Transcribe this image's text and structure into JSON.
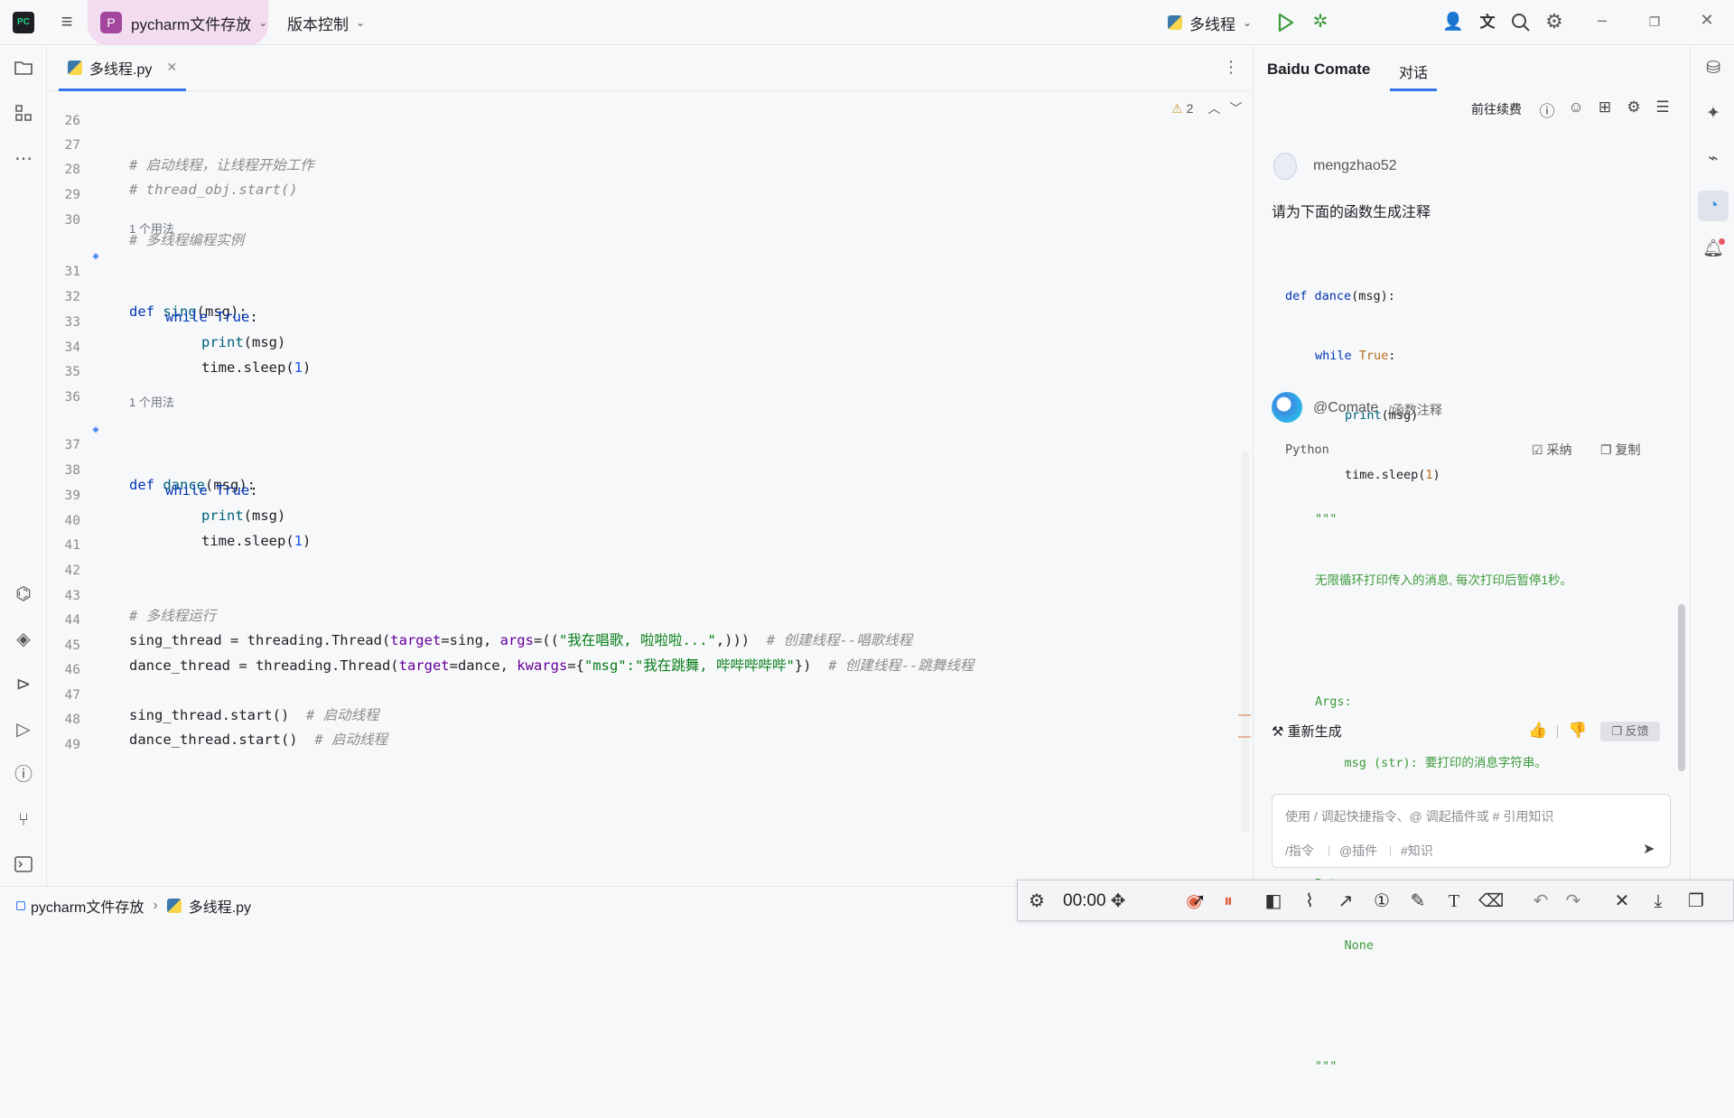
{
  "titlebar": {
    "project_badge": "P",
    "project_name": "pycharm文件存放",
    "vcs_label": "版本控制",
    "run_config": "多线程"
  },
  "editor": {
    "tab_label": "多线程.py",
    "inspection_count": "2",
    "lines": [
      {
        "n": "26"
      },
      {
        "n": "27",
        "t": "# 启动线程，让线程开始工作"
      },
      {
        "n": "28",
        "t": "# thread_obj.start()"
      },
      {
        "n": "29"
      },
      {
        "n": "30",
        "t": "# 多线程编程实例"
      },
      {
        "hint": "1 个用法"
      },
      {
        "n": "31",
        "kw": "def",
        "fn": "sing",
        "rest": "(msg):"
      },
      {
        "n": "32",
        "kw1": "while",
        "kw2": "True",
        "rest": ":"
      },
      {
        "n": "33",
        "fn": "print",
        "rest": "(msg)"
      },
      {
        "n": "34",
        "a": "time.sleep(",
        "num": "1",
        "b": ")"
      },
      {
        "n": "35"
      },
      {
        "n": "36"
      },
      {
        "hint": "1 个用法"
      },
      {
        "n": "37",
        "kw": "def",
        "fn": "dance",
        "rest": "(msg):"
      },
      {
        "n": "38",
        "kw1": "while",
        "kw2": "True",
        "rest": ":"
      },
      {
        "n": "39",
        "fn": "print",
        "rest": "(msg)"
      },
      {
        "n": "40",
        "a": "time.sleep(",
        "num": "1",
        "b": ")"
      },
      {
        "n": "41"
      },
      {
        "n": "42"
      },
      {
        "n": "43",
        "t": "# 多线程运行"
      },
      {
        "n": "44",
        "a": "sing_thread = threading.Thread(",
        "k1": "target",
        "b": "=sing, ",
        "k2": "args",
        "c": "=((",
        "s": "\"我在唱歌, 啦啦啦...\"",
        "d": ",)))  ",
        "cm": "# 创建线程--唱歌线程"
      },
      {
        "n": "45",
        "a": "dance_thread = threading.Thread(",
        "k1": "target",
        "b": "=dance, ",
        "k2": "kwargs",
        "c": "={",
        "s": "\"msg\":\"我在跳舞, 哔哔哔哔哔\"",
        "d": "})  ",
        "cm": "# 创建线程--跳舞线程"
      },
      {
        "n": "46"
      },
      {
        "n": "47",
        "a": "sing_thread.start()  ",
        "cm": "# 启动线程"
      },
      {
        "n": "48",
        "a": "dance_thread.start()  ",
        "cm": "# 启动线程"
      },
      {
        "n": "49"
      }
    ]
  },
  "comate": {
    "title": "Baidu Comate",
    "tab_chat": "对话",
    "renew_label": "前往续费",
    "user_name": "mengzhao52",
    "user_prompt": "请为下面的函数生成注释",
    "user_code": {
      "l1_kw": "def",
      "l1_fn": "dance",
      "l1_rest": "(msg):",
      "l2_kw": "while",
      "l2_true": "True",
      "l2_rest": ":",
      "l3_fn": "print",
      "l3_rest": "(msg)",
      "l4_a": "time.sleep(",
      "l4_num": "1",
      "l4_b": ")"
    },
    "bot_name": "@Comate",
    "bot_command": "/函数注释",
    "answer_lang": "Python",
    "accept_label": "采纳",
    "copy_label": "复制",
    "answer_lines": [
      "\"\"\"",
      "无限循环打印传入的消息, 每次打印后暂停1秒。",
      "",
      "Args:",
      "    msg (str): 要打印的消息字符串。",
      "",
      "Returns:",
      "    None",
      "",
      "\"\"\""
    ],
    "regenerate_label": "重新生成",
    "feedback_label": "反馈",
    "input_placeholder": "使用 / 调起快捷指令、@ 调起插件或 # 引用知识",
    "chip_command": "/指令",
    "chip_plugin": "@插件",
    "chip_knowledge": "#知识"
  },
  "statusbar": {
    "crumb_project": "pycharm文件存放",
    "crumb_file": "多线程.py"
  },
  "recorder": {
    "timer": "00:00"
  },
  "colors": {
    "project_chip": "#f3dcef",
    "project_badge": "#a2479d",
    "accent": "#3574f0",
    "keyword": "#0033b3",
    "function": "#00627a",
    "string": "#067d17",
    "comment": "#8c8c8c",
    "run_green": "#3d9a3a",
    "record_red": "#e05a38"
  }
}
